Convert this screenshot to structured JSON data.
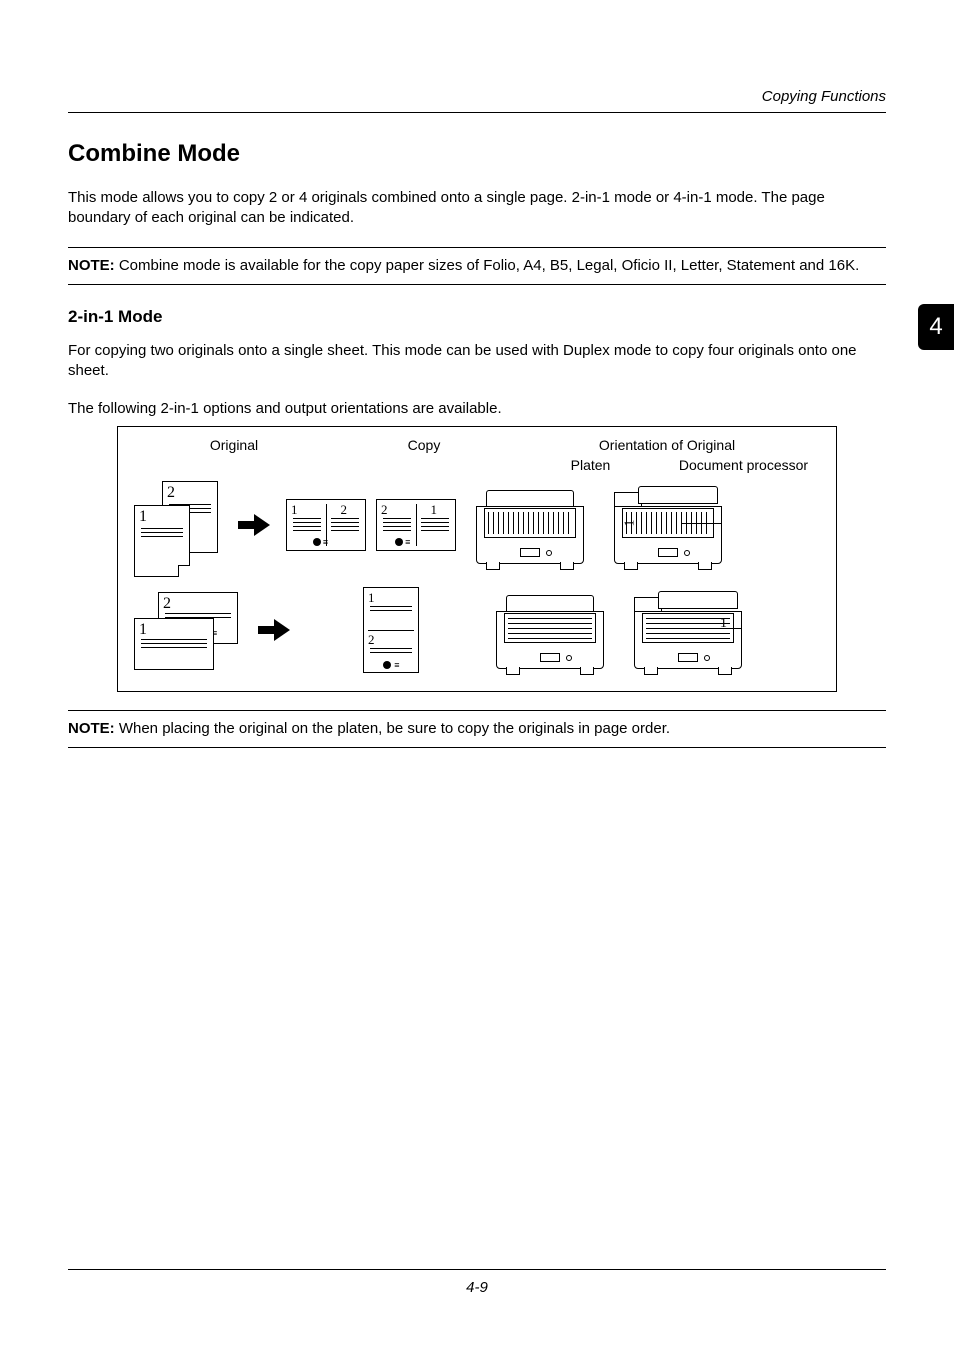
{
  "running_header": "Copying Functions",
  "chapter_tab": "4",
  "section_title": "Combine Mode",
  "intro_paragraph": "This mode allows you to copy 2 or 4 originals combined onto a single page. 2-in-1 mode or 4-in-1 mode. The page boundary of each original can be indicated.",
  "note1": {
    "lead": "NOTE:",
    "text": " Combine mode is available for the copy paper sizes of Folio, A4, B5, Legal, Oficio II, Letter, Statement and 16K."
  },
  "subsection_title": "2-in-1 Mode",
  "sub_paragraph": "For copying two originals onto a single sheet. This mode can be used with Duplex mode to copy four originals onto one sheet.",
  "options_sentence": "The following 2-in-1 options and output orientations are available.",
  "diagram": {
    "col_original": "Original",
    "col_copy": "Copy",
    "col_orientation": "Orientation of Original",
    "col_platen": "Platen",
    "col_dp": "Document processor",
    "nums": {
      "one": "1",
      "two": "2"
    }
  },
  "note2": {
    "lead": "NOTE:",
    "text": " When placing the original on the platen, be sure to copy the originals in page order."
  },
  "page_number": "4-9"
}
